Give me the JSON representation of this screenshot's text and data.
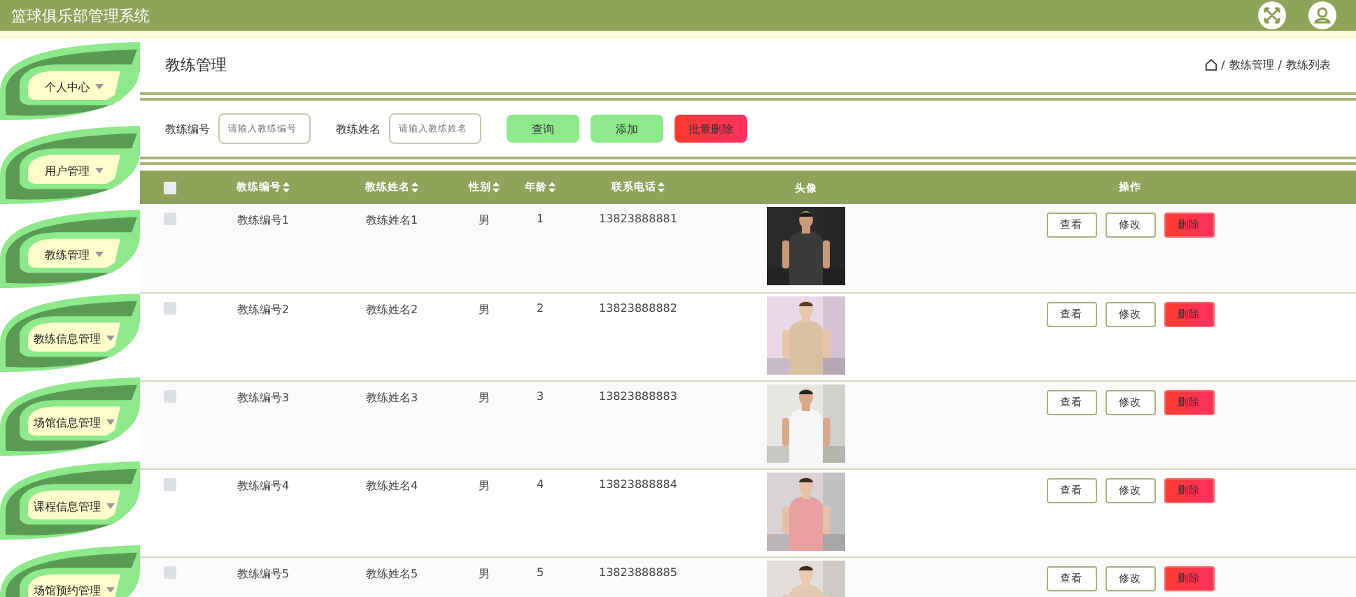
{
  "header": {
    "title": "篮球俱乐部管理系统"
  },
  "sidebar": {
    "items": [
      {
        "label": "个人中心"
      },
      {
        "label": "用户管理"
      },
      {
        "label": "教练管理"
      },
      {
        "label": "教练信息管理"
      },
      {
        "label": "场馆信息管理"
      },
      {
        "label": "课程信息管理"
      },
      {
        "label": "场馆预约管理"
      }
    ]
  },
  "page_title": "教练管理",
  "breadcrumb": [
    {
      "separator": "/",
      "label": "教练管理"
    },
    {
      "separator": "/",
      "label": "教练列表"
    }
  ],
  "search": {
    "fields": [
      {
        "label": "教练编号",
        "placeholder": "请输入教练编号"
      },
      {
        "label": "教练姓名",
        "placeholder": "请输入教练姓名"
      }
    ],
    "buttons": [
      {
        "label": "查询",
        "kind": "normal"
      },
      {
        "label": "添加",
        "kind": "normal"
      },
      {
        "label": "批量删除",
        "kind": "danger"
      }
    ]
  },
  "table": {
    "select_all_checked": false,
    "columns": [
      {
        "label": "教练编号",
        "sortable": true
      },
      {
        "label": "教练姓名",
        "sortable": true
      },
      {
        "label": "性别",
        "sortable": true
      },
      {
        "label": "年龄",
        "sortable": true
      },
      {
        "label": "联系电话",
        "sortable": true
      },
      {
        "label": "头像",
        "sortable": false
      },
      {
        "label": "操作",
        "sortable": false
      }
    ],
    "rows": [
      {
        "checked": false,
        "cells": [
          "教练编号1",
          "教练姓名1",
          "男",
          "1",
          "13823888881"
        ],
        "actions": [
          "查看",
          "修改",
          "删除"
        ]
      },
      {
        "checked": false,
        "cells": [
          "教练编号2",
          "教练姓名2",
          "男",
          "2",
          "13823888882"
        ],
        "actions": [
          "查看",
          "修改",
          "删除"
        ]
      },
      {
        "checked": false,
        "cells": [
          "教练编号3",
          "教练姓名3",
          "男",
          "3",
          "13823888883"
        ],
        "actions": [
          "查看",
          "修改",
          "删除"
        ]
      },
      {
        "checked": false,
        "cells": [
          "教练编号4",
          "教练姓名4",
          "男",
          "4",
          "13823888884"
        ],
        "actions": [
          "查看",
          "修改",
          "删除"
        ]
      },
      {
        "checked": false,
        "cells": [
          "教练编号5",
          "教练姓名5",
          "男",
          "5",
          "13823888885"
        ],
        "actions": [
          "查看",
          "修改",
          "删除"
        ]
      }
    ]
  }
}
